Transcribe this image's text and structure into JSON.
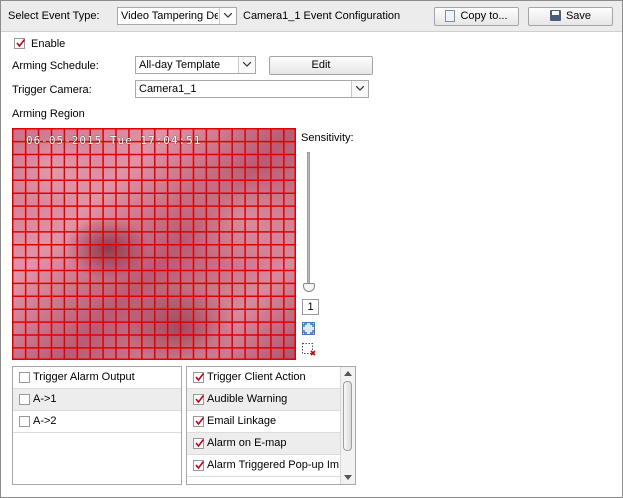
{
  "header": {
    "event_type_label": "Select Event Type:",
    "event_type_value": "Video Tampering Det...",
    "config_title": "Camera1_1 Event Configuration",
    "copy_button": "Copy to...",
    "save_button": "Save"
  },
  "form": {
    "enable_label": "Enable",
    "enable_checked": true,
    "arming_schedule_label": "Arming Schedule:",
    "arming_schedule_value": "All-day Template",
    "edit_button": "Edit",
    "trigger_camera_label": "Trigger Camera:",
    "trigger_camera_value": "Camera1_1",
    "arming_region_label": "Arming Region"
  },
  "video": {
    "osd_text": "06-05-2015 Tue 17:04:51",
    "grid_color": "#e00000"
  },
  "sensitivity": {
    "label": "Sensitivity:",
    "value": "1",
    "level_fraction": 0
  },
  "outputs": {
    "items": [
      {
        "label": "Trigger Alarm Output",
        "checked": false
      },
      {
        "label": "A->1",
        "checked": false
      },
      {
        "label": "A->2",
        "checked": false
      }
    ]
  },
  "actions": {
    "items": [
      {
        "label": "Trigger Client Action",
        "checked": true
      },
      {
        "label": "Audible Warning",
        "checked": true
      },
      {
        "label": "Email Linkage",
        "checked": true
      },
      {
        "label": "Alarm on E-map",
        "checked": true
      },
      {
        "label": "Alarm Triggered Pop-up Im...",
        "checked": true
      }
    ]
  },
  "colors": {
    "check_mark": "#c0001a"
  }
}
